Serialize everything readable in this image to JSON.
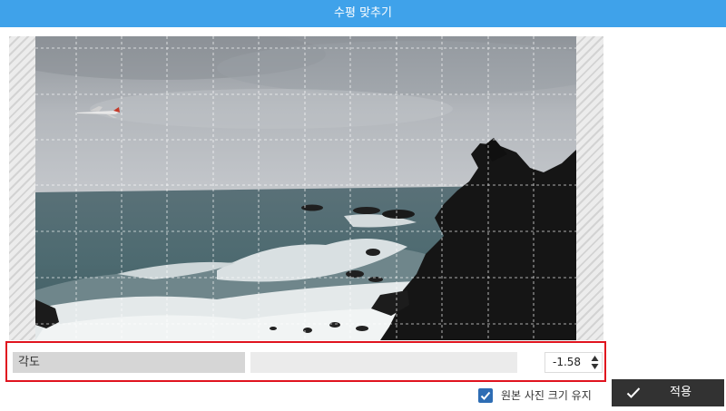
{
  "window": {
    "title": "수평 맞추기"
  },
  "angle": {
    "label": "각도",
    "value": "-1.58"
  },
  "options": {
    "keep_original_size": {
      "label": "원본 사진 크기 유지",
      "checked": true
    }
  },
  "actions": {
    "apply_label": "적용"
  },
  "icons": {
    "spinner": "up-down-arrow-icon",
    "checkbox": "checkmark-icon",
    "apply": "checkmark-icon"
  },
  "colors": {
    "title_bar": "#3fa2ea",
    "highlight_frame": "#e0141f",
    "checkbox": "#2e6db4",
    "apply_button": "#323232"
  }
}
